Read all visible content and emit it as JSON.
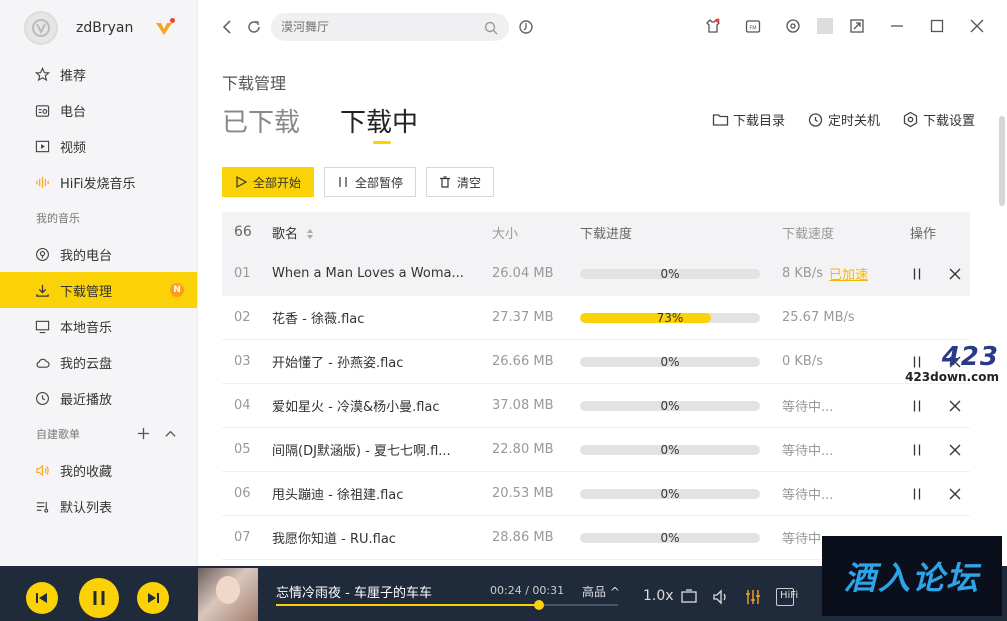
{
  "profile": {
    "username": "zdBryan"
  },
  "sidebar": {
    "items": [
      {
        "label": "推荐",
        "icon": "star-icon"
      },
      {
        "label": "电台",
        "icon": "radio-icon"
      },
      {
        "label": "视频",
        "icon": "video-icon"
      },
      {
        "label": "HiFi发烧音乐",
        "icon": "hifi-wave-icon"
      }
    ],
    "my_music_title": "我的音乐",
    "my_music": [
      {
        "label": "我的电台",
        "icon": "my-radio-icon"
      },
      {
        "label": "下载管理",
        "icon": "download-icon",
        "active": true,
        "badge": "N"
      },
      {
        "label": "本地音乐",
        "icon": "monitor-icon"
      },
      {
        "label": "我的云盘",
        "icon": "cloud-icon"
      },
      {
        "label": "最近播放",
        "icon": "clock-icon"
      }
    ],
    "playlist_title": "自建歌单",
    "playlists": [
      {
        "label": "我的收藏",
        "icon": "heart-sound-icon"
      },
      {
        "label": "默认列表",
        "icon": "list-icon"
      }
    ]
  },
  "search": {
    "placeholder": "漠河舞厅"
  },
  "page": {
    "title": "下载管理",
    "tabs": [
      {
        "label": "已下载",
        "active": false
      },
      {
        "label": "下载中",
        "active": true
      }
    ],
    "actions": {
      "folder": "下载目录",
      "timer": "定时关机",
      "settings": "下载设置"
    },
    "buttons": {
      "start_all": "全部开始",
      "pause_all": "全部暂停",
      "clear": "清空"
    }
  },
  "table": {
    "count": "66",
    "headers": {
      "name": "歌名",
      "size": "大小",
      "progress": "下载进度",
      "speed": "下载速度",
      "ops": "操作"
    },
    "rows": [
      {
        "idx": "01",
        "name": "When a Man Loves a Woma...",
        "size": "26.04 MB",
        "progress": 0,
        "progress_text": "0%",
        "speed": "8 KB/s",
        "accel": "已加速",
        "ops": true
      },
      {
        "idx": "02",
        "name": "花香 - 徐薇.flac",
        "size": "27.37 MB",
        "progress": 73,
        "progress_text": "73%",
        "speed": "25.67 MB/s",
        "ops": false
      },
      {
        "idx": "03",
        "name": "开始懂了 - 孙燕姿.flac",
        "size": "26.66 MB",
        "progress": 0,
        "progress_text": "0%",
        "speed": "0 KB/s",
        "ops": true
      },
      {
        "idx": "04",
        "name": "爱如星火 - 冷漠&杨小曼.flac",
        "size": "37.08 MB",
        "progress": 0,
        "progress_text": "0%",
        "speed": "等待中...",
        "ops": true
      },
      {
        "idx": "05",
        "name": "间隔(DJ默涵版)  - 夏七七啊.fl...",
        "size": "22.80 MB",
        "progress": 0,
        "progress_text": "0%",
        "speed": "等待中...",
        "ops": true
      },
      {
        "idx": "06",
        "name": "甩头蹦迪 - 徐祖建.flac",
        "size": "20.53 MB",
        "progress": 0,
        "progress_text": "0%",
        "speed": "等待中...",
        "ops": true
      },
      {
        "idx": "07",
        "name": "我愿你知道 - RU.flac",
        "size": "28.86 MB",
        "progress": 0,
        "progress_text": "0%",
        "speed": "等待中...",
        "ops": false
      }
    ]
  },
  "player": {
    "song": "忘情冷雨夜 - 车厘子的车车",
    "time": "00:24 / 00:31",
    "quality": "高品",
    "rate": "1.0x",
    "hifi": "HiFi",
    "progress": 0.77
  },
  "watermarks": {
    "site_big": "423",
    "site_small": "423down.com",
    "forum": "酒入论坛"
  },
  "colors": {
    "accent": "#fbd207",
    "player_bg": "#1f2a3a",
    "accel": "#f5b800"
  }
}
